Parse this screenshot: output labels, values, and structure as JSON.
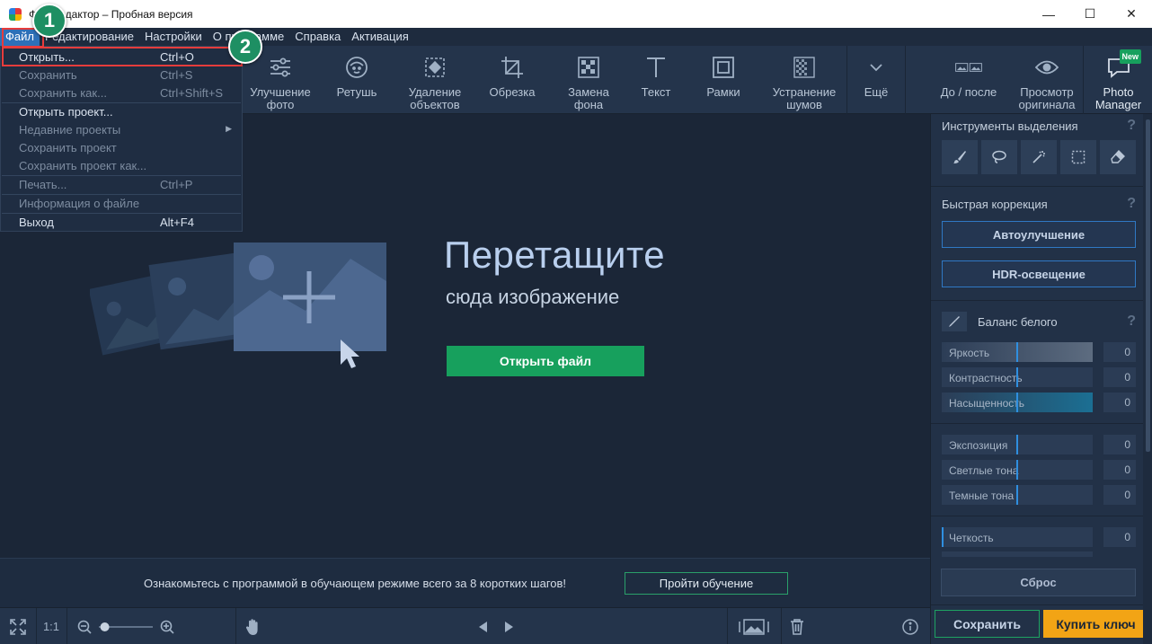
{
  "window": {
    "title_visible": "М       ФотоDредактор – Пробная версия",
    "title": "Фоторедактор – Пробная версия",
    "controls": [
      "—",
      "☐",
      "✕"
    ]
  },
  "menubar": {
    "items": [
      "Файл",
      "Редактирование",
      "Настройки",
      "О программе",
      "Справка",
      "Активация"
    ],
    "visible_labels": [
      "Файл",
      "Редактирование",
      "Настройки",
      "программе",
      "Справка",
      "Активация"
    ]
  },
  "file_menu": {
    "items": [
      {
        "label": "Открыть...",
        "shortcut": "Ctrl+O",
        "enabled": true
      },
      {
        "label": "Сохранить",
        "shortcut": "Ctrl+S",
        "enabled": false
      },
      {
        "label": "Сохранить как...",
        "shortcut": "Ctrl+Shift+S",
        "enabled": false
      },
      {
        "label": "Открыть проект...",
        "shortcut": "",
        "enabled": true
      },
      {
        "label": "Недавние проекты",
        "shortcut": "",
        "enabled": false
      },
      {
        "label": "Сохранить проект",
        "shortcut": "",
        "enabled": false
      },
      {
        "label": "Сохранить проект как...",
        "shortcut": "",
        "enabled": false
      },
      {
        "label": "Печать...",
        "shortcut": "Ctrl+P",
        "enabled": false
      },
      {
        "label": "Информация о файле",
        "shortcut": "",
        "enabled": false
      },
      {
        "label": "Выход",
        "shortcut": "Alt+F4",
        "enabled": true
      }
    ]
  },
  "toolbar": {
    "tools": [
      {
        "label": "Улучшение\nфото",
        "icon": "sliders-icon"
      },
      {
        "label": "Ретушь",
        "icon": "face-icon"
      },
      {
        "label": "Удаление\nобъектов",
        "icon": "eraser-icon"
      },
      {
        "label": "Обрезка",
        "icon": "crop-icon"
      },
      {
        "label": "Замена\nфона",
        "icon": "background-icon"
      },
      {
        "label": "Текст",
        "icon": "text-icon"
      },
      {
        "label": "Рамки",
        "icon": "frame-icon"
      },
      {
        "label": "Устранение\nшумов",
        "icon": "noise-icon"
      },
      {
        "label": "Ещё",
        "icon": "chevron-down-icon"
      }
    ],
    "compare": {
      "label": "До / после",
      "icon": "before-after-icon"
    },
    "preview": {
      "label": "Просмотр\nоригинала",
      "icon": "eye-icon"
    },
    "photo_manager": {
      "label": "Photo\nManager",
      "badge": "New",
      "icon": "chat-icon"
    }
  },
  "workarea": {
    "title": "Перетащите",
    "subtitle": "сюда изображение",
    "open_button": "Открыть файл"
  },
  "tutorial": {
    "text": "Ознакомьтесь с программой в обучающем режиме всего за 8 коротких шагов!",
    "button": "Пройти обучение"
  },
  "bottombar": {
    "zoom_ratio": "1:1",
    "zoom_level": 0.05
  },
  "right_panel": {
    "selection_title": "Инструменты выделения",
    "selection_tools": [
      "brush-icon",
      "lasso-icon",
      "magic-wand-icon",
      "rect-select-icon",
      "eraser-icon"
    ],
    "quick_title": "Быстрая коррекция",
    "auto_button": "Автоулучшение",
    "hdr_button": "HDR-освещение",
    "wb_title": "Баланс белого",
    "sliders": [
      {
        "label": "Яркость",
        "value": "0"
      },
      {
        "label": "Контрастность",
        "value": "0"
      },
      {
        "label": "Насыщенность",
        "value": "0"
      },
      {
        "label": "Экспозиция",
        "value": "0"
      },
      {
        "label": "Светлые тона",
        "value": "0"
      },
      {
        "label": "Темные тона",
        "value": "0"
      },
      {
        "label": "Четкость",
        "value": "0"
      }
    ],
    "reset_button": "Сброс",
    "save_button": "Сохранить",
    "buy_button": "Купить ключ",
    "help_glyph": "?"
  },
  "callouts": [
    "1",
    "2"
  ],
  "colors": {
    "accent_green": "#17a05d",
    "accent_orange": "#f2a415",
    "accent_blue": "#2f78c4",
    "annotation_red": "#e63c3c"
  }
}
